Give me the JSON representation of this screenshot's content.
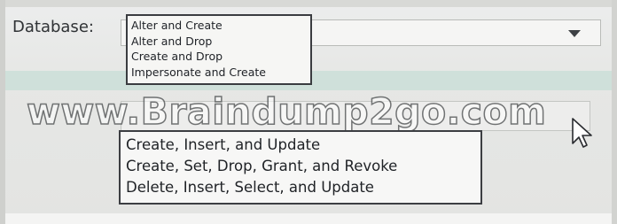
{
  "database": {
    "label": "Database:",
    "options": [
      "Alter and Create",
      "Alter and Drop",
      "Create and Drop",
      "Impersonate and Create"
    ]
  },
  "permissions": {
    "options": [
      "Create, Insert, and Update",
      "Create, Set, Drop, Grant, and Revoke",
      "Delete, Insert, Select, and Update"
    ]
  },
  "watermark": "www.Braindump2go.com",
  "icons": {
    "dropdown": "chevron-down-icon",
    "pointer": "mouse-pointer-icon"
  },
  "colors": {
    "accent_band": "#cfe0da",
    "list_border": "#3a3c40"
  }
}
